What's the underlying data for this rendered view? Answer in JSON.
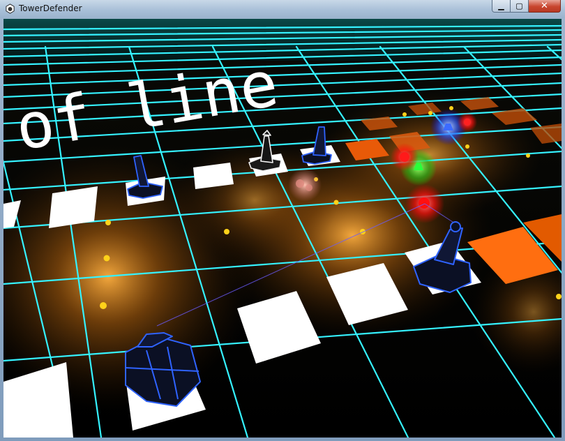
{
  "window": {
    "title": "TowerDefender"
  },
  "controls": {
    "minimize": "▁",
    "maximize": "▢",
    "close": "✕"
  },
  "game": {
    "overlay_text": "of line",
    "colors": {
      "grid": "#35f2ff",
      "tile": "#ffffff",
      "tower_body": "#0b1024",
      "tower_edge": "#2f63ff",
      "orange_tile": "#ff6a00",
      "node_glow": "#ffb020"
    }
  }
}
